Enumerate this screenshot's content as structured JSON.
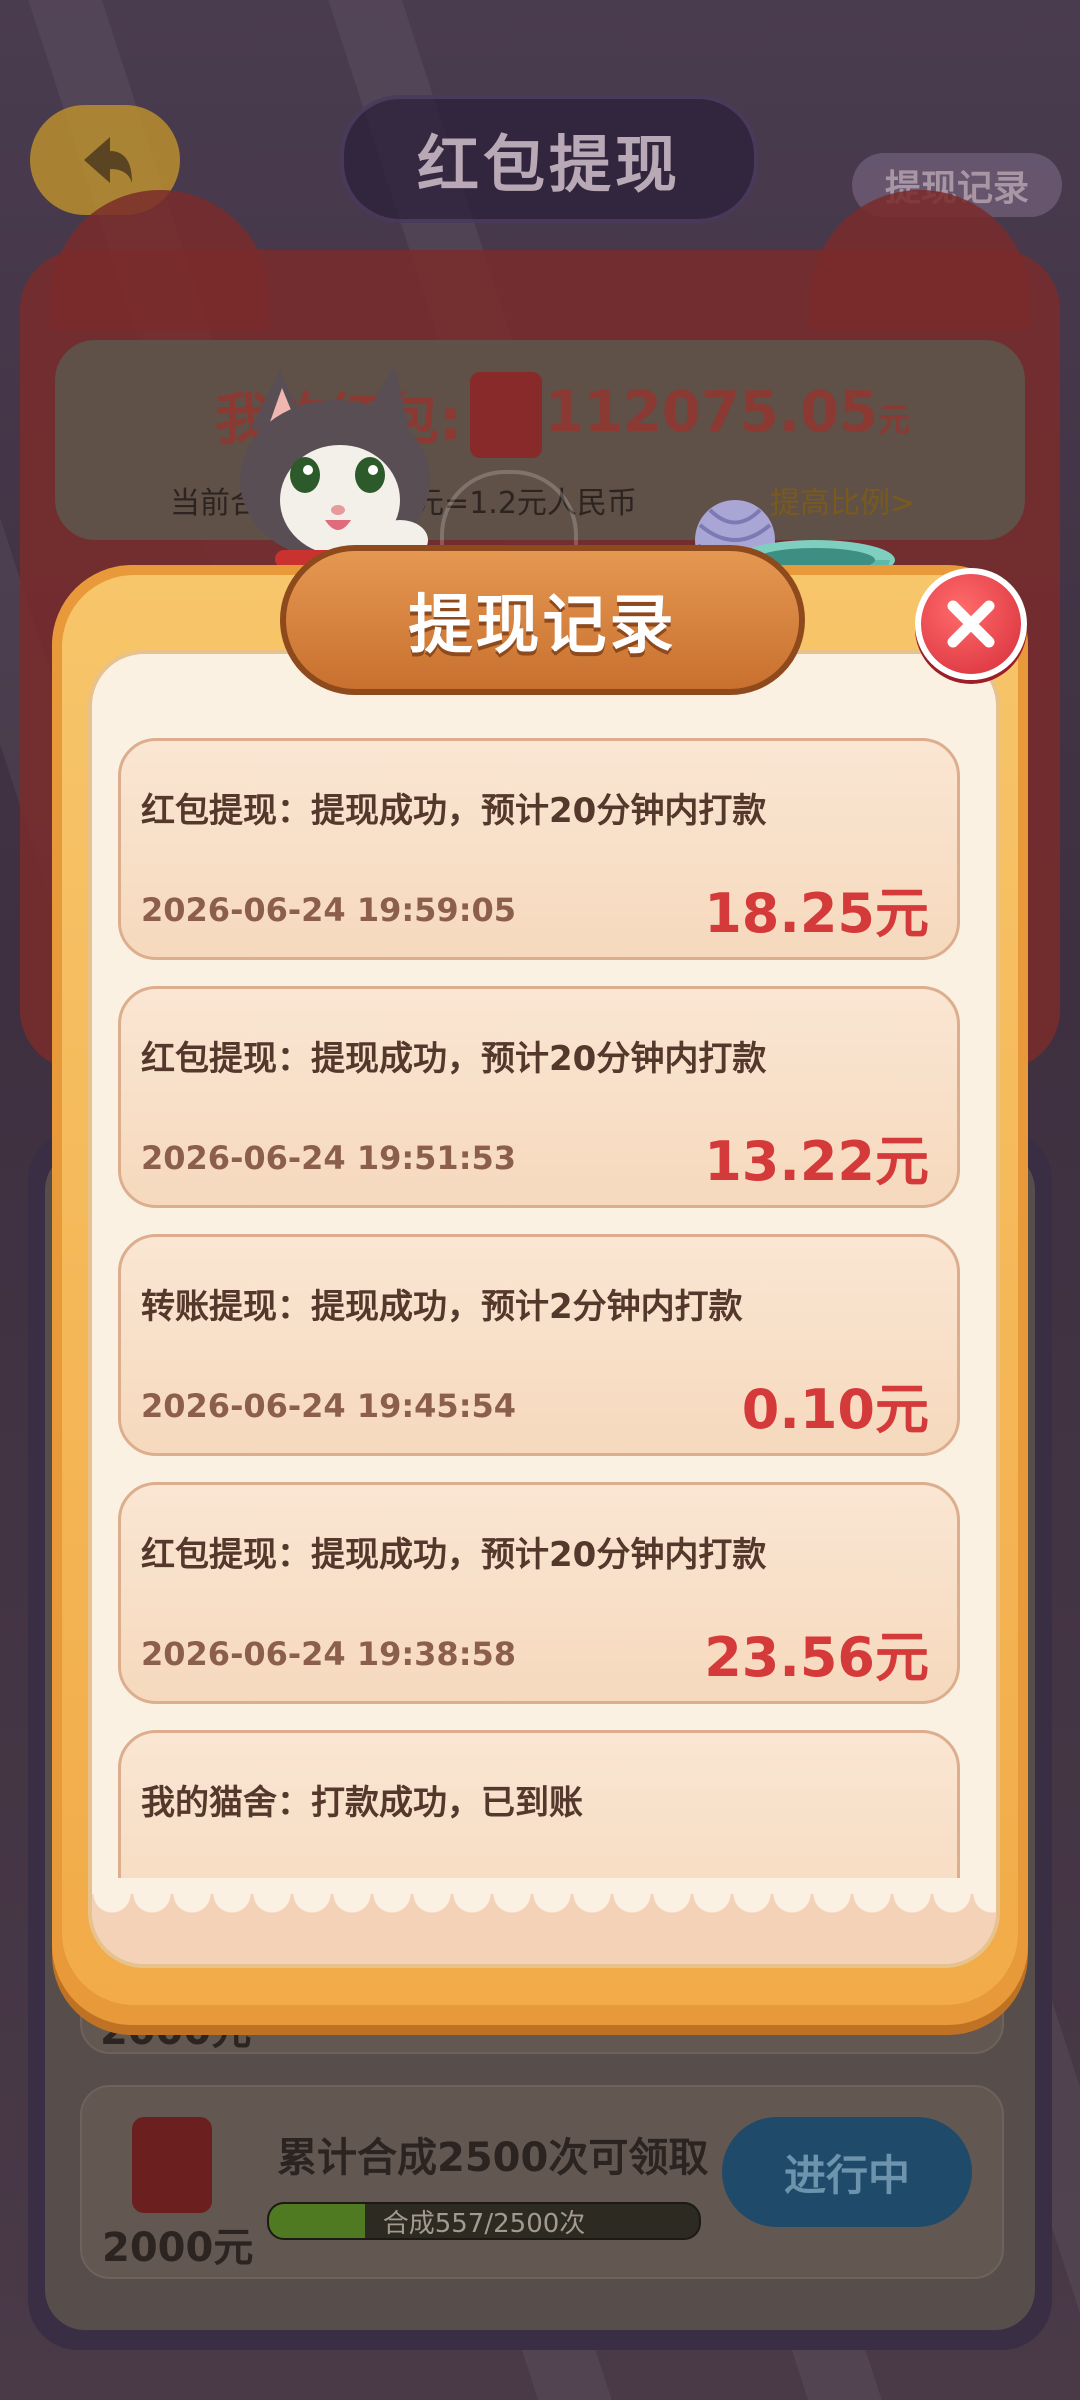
{
  "header": {
    "title": "红包提现",
    "record_link": "提现记录"
  },
  "balance": {
    "label": "我的红包:",
    "value": "112075.05",
    "unit": "元",
    "ratio_text": "当前合成5 10000元=1.2元人民币",
    "ratio_link": "提高比例>"
  },
  "background_tasks": {
    "prev_amount": "2000元",
    "task": {
      "amount": "2000元",
      "title": "累计合成2500次可领取",
      "progress_text": "合成557/2500次",
      "progress_fraction": 0.2228,
      "button": "进行中"
    }
  },
  "modal": {
    "title": "提现记录",
    "close_icon": "close-icon",
    "records": [
      {
        "desc": "红包提现：提现成功，预计20分钟内打款",
        "time": "2026-06-24 19:59:05",
        "amount": "18.25元"
      },
      {
        "desc": "红包提现：提现成功，预计20分钟内打款",
        "time": "2026-06-24 19:51:53",
        "amount": "13.22元"
      },
      {
        "desc": "转账提现：提现成功，预计2分钟内打款",
        "time": "2026-06-24 19:45:54",
        "amount": "0.10元"
      },
      {
        "desc": "红包提现：提现成功，预计20分钟内打款",
        "time": "2026-06-24 19:38:58",
        "amount": "23.56元"
      },
      {
        "desc": "我的猫舍：打款成功，已到账",
        "time": "",
        "amount": ""
      }
    ]
  },
  "colors": {
    "accent_red": "#d43a3a",
    "modal_orange": "#e89a3a",
    "card_border": "#dcae8e"
  }
}
